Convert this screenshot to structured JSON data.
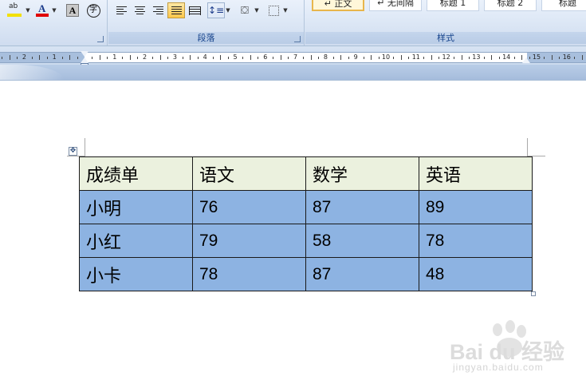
{
  "ribbon": {
    "paragraph_group_label": "段落",
    "styles_group_label": "样式",
    "font_group": {
      "highlight_label": "ab",
      "font_color_label": "A",
      "char_shading_label": "A",
      "enclose_label": "字"
    },
    "styles": [
      {
        "label": "↵ 正文",
        "selected": true
      },
      {
        "label": "↵ 无间隔",
        "selected": false
      },
      {
        "label": "标题 1",
        "selected": false
      },
      {
        "label": "标题 2",
        "selected": false
      },
      {
        "label": "标题",
        "selected": false
      }
    ],
    "colors": {
      "highlight": "#f2e000",
      "font_color": "#e00000",
      "active_button": "#ffc84a"
    }
  },
  "ruler": {
    "numbers": [
      "2",
      "1",
      "1",
      "2",
      "3",
      "4",
      "5",
      "6",
      "7",
      "8",
      "9",
      "10",
      "11",
      "12",
      "13",
      "14",
      "15",
      "16"
    ]
  },
  "table": {
    "header": [
      "成绩单",
      "语文",
      "数学",
      "英语"
    ],
    "rows": [
      [
        "小明",
        "76",
        "87",
        "89"
      ],
      [
        "小红",
        "79",
        "58",
        "78"
      ],
      [
        "小卡",
        "78",
        "87",
        "48"
      ]
    ],
    "header_bg": "#ebf1de",
    "body_bg": "#8db3e2"
  },
  "watermark": {
    "brand": "Bai du 经验",
    "url": "jingyan.baidu.com"
  }
}
